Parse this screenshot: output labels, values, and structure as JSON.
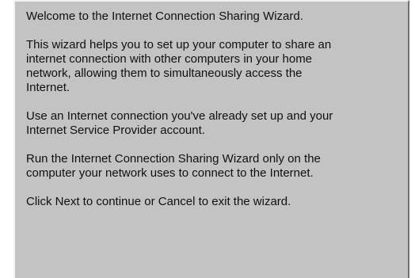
{
  "wizard": {
    "welcome_title": "Welcome to the Internet Connection Sharing Wizard.",
    "paragraphs": [
      "This wizard helps you to set up your computer to share an\ninternet connection with other computers in your home\nnetwork, allowing them to simultaneously access the\nInternet.",
      "Use an Internet connection you've already set up and your\nInternet Service Provider account.",
      "Run the Internet Connection Sharing Wizard only on the\ncomputer your network uses to connect to the Internet.",
      "Click Next to continue or Cancel to exit the wizard."
    ]
  }
}
